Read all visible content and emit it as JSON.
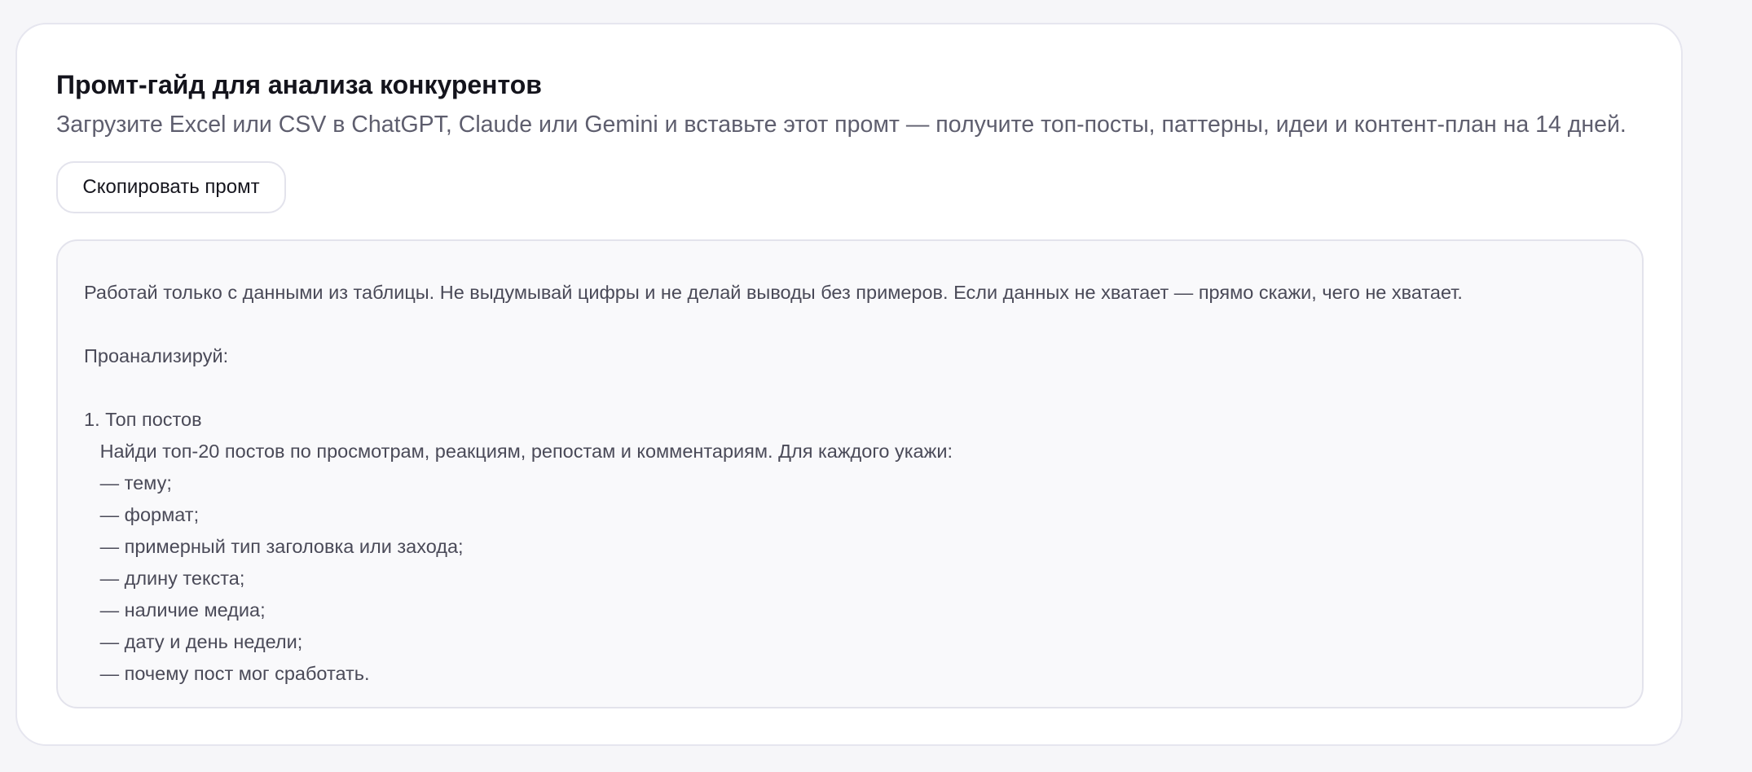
{
  "card": {
    "title": "Промт-гайд для анализа конкурентов",
    "subtitle": "Загрузите Excel или CSV в ChatGPT, Claude или Gemini и вставьте этот промт — получите топ-посты, паттерны, идеи и контент-план на 14 дней.",
    "copy_button_label": "Скопировать промт"
  },
  "prompt": {
    "text": "Работай только с данными из таблицы. Не выдумывай цифры и не делай выводы без примеров. Если данных не хватает — прямо скажи, чего не хватает.\n\nПроанализируй:\n\n1. Топ постов\n   Найди топ-20 постов по просмотрам, реакциям, репостам и комментариям. Для каждого укажи:\n   — тему;\n   — формат;\n   — примерный тип заголовка или захода;\n   — длину текста;\n   — наличие медиа;\n   — дату и день недели;\n   — почему пост мог сработать."
  }
}
